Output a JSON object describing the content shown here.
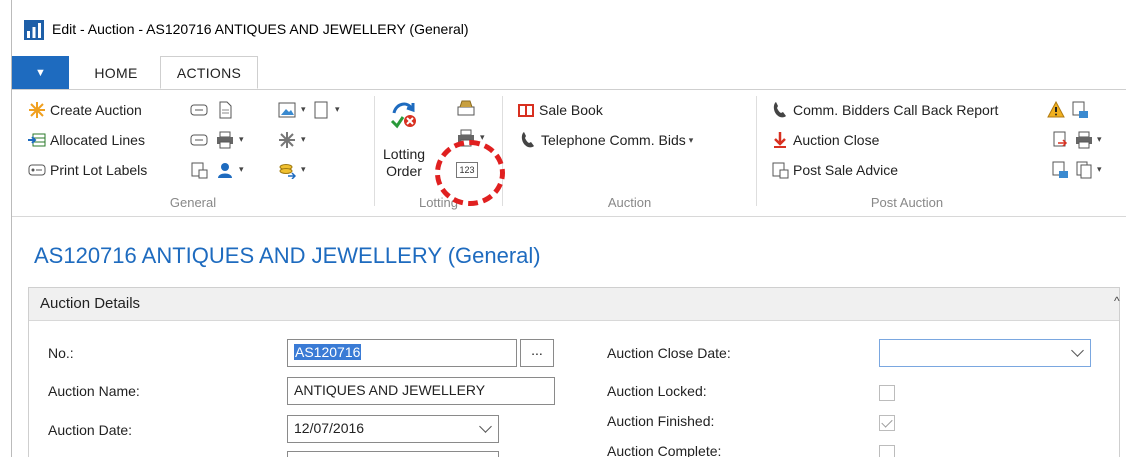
{
  "window": {
    "title": "Edit - Auction - AS120716 ANTIQUES AND JEWELLERY (General)"
  },
  "tabs": {
    "file_glyph": "▼",
    "home": "HOME",
    "actions": "ACTIONS"
  },
  "ribbon": {
    "general": {
      "label": "General",
      "create_auction": "Create Auction",
      "allocated_lines": "Allocated Lines",
      "print_lot_labels": "Print Lot Labels"
    },
    "lotting": {
      "label": "Lotting",
      "lotting_order_line1": "Lotting",
      "lotting_order_line2": "Order",
      "number_badge": "123"
    },
    "auction": {
      "label": "Auction",
      "sale_book": "Sale Book",
      "telephone_comm_bids": "Telephone Comm. Bids"
    },
    "post_auction": {
      "label": "Post Auction",
      "comm_bidders_call_back_report": "Comm. Bidders Call Back Report",
      "auction_close": "Auction Close",
      "post_sale_advice": "Post Sale Advice"
    }
  },
  "page": {
    "title": "AS120716 ANTIQUES AND JEWELLERY (General)"
  },
  "details": {
    "section_title": "Auction Details",
    "no_label": "No.:",
    "no_value": "AS120716",
    "lookup": "...",
    "auction_name_label": "Auction Name:",
    "auction_name_value": "ANTIQUES AND JEWELLERY",
    "auction_date_label": "Auction Date:",
    "auction_date_value": "12/07/2016",
    "close_date_label": "Auction Close Date:",
    "close_date_value": "",
    "locked_label": "Auction Locked:",
    "locked": false,
    "finished_label": "Auction Finished:",
    "finished": true,
    "complete_label": "Auction Complete:",
    "complete": false
  },
  "colors": {
    "accent": "#1e6bbf",
    "highlight": "#e02020"
  }
}
